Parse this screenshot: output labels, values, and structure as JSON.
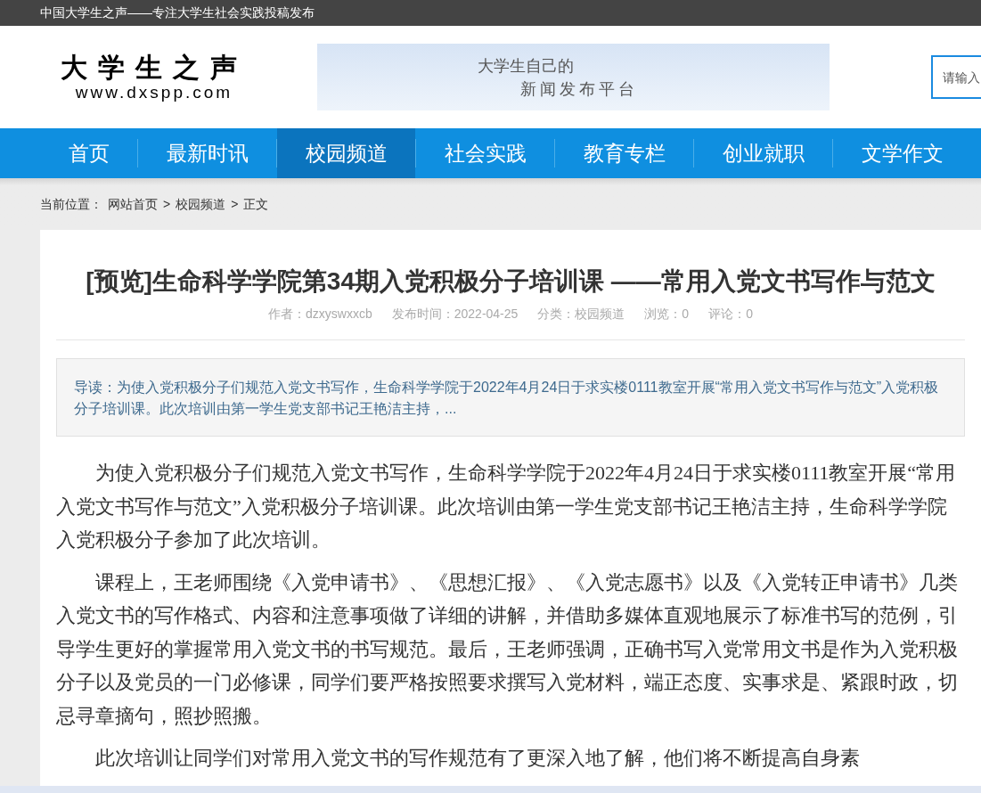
{
  "top_bar": {
    "text": "中国大学生之声——专注大学生社会实践投稿发布"
  },
  "header": {
    "logo": {
      "title": "大学生之声",
      "url": "www.dxspp.com"
    },
    "banner": {
      "line_1": "大学生自己的",
      "line_2": "新闻发布平台"
    },
    "search": {
      "placeholder": "请输入"
    }
  },
  "nav": [
    {
      "label": "首页",
      "selected": false
    },
    {
      "label": "最新时讯",
      "selected": false
    },
    {
      "label": "校园频道",
      "selected": true
    },
    {
      "label": "社会实践",
      "selected": false
    },
    {
      "label": "教育专栏",
      "selected": false
    },
    {
      "label": "创业就职",
      "selected": false
    },
    {
      "label": "文学作文",
      "selected": false
    }
  ],
  "breadcrumb": {
    "label": "当前位置：",
    "items": [
      "网站首页",
      "校园频道",
      "正文"
    ],
    "separator": ">"
  },
  "article": {
    "title": "[预览]生命科学学院第34期入党积极分子培训课 ——常用入党文书写作与范文",
    "meta": [
      "作者：dzxyswxxcb",
      "发布时间：2022-04-25",
      "分类：校园频道",
      "浏览：0",
      "评论：0"
    ],
    "summary": "导读：为使入党积极分子们规范入党文书写作，生命科学学院于2022年4月24日于求实楼0111教室开展“常用入党文书写作与范文”入党积极分子培训课。此次培训由第一学生党支部书记王艳洁主持，...",
    "paragraphs": [
      "为使入党积极分子们规范入党文书写作，生命科学学院于2022年4月24日于求实楼0111教室开展“常用入党文书写作与范文”入党积极分子培训课。此次培训由第一学生党支部书记王艳洁主持，生命科学学院入党积极分子参加了此次培训。",
      "课程上，王老师围绕《入党申请书》、《思想汇报》、《入党志愿书》以及《入党转正申请书》几类入党文书的写作格式、内容和注意事项做了详细的讲解，并借助多媒体直观地展示了标准书写的范例，引导学生更好的掌握常用入党文书的书写规范。最后，王老师强调，正确书写入党常用文书是作为入党积极分子以及党员的一门必修课，同学们要严格按照要求撰写入党材料，端正态度、实事求是、紧跟时政，切忌寻章摘句，照抄照搬。",
      "此次培训让同学们对常用入党文书的写作规范有了更深入地了解，他们将不断提高自身素"
    ]
  }
}
